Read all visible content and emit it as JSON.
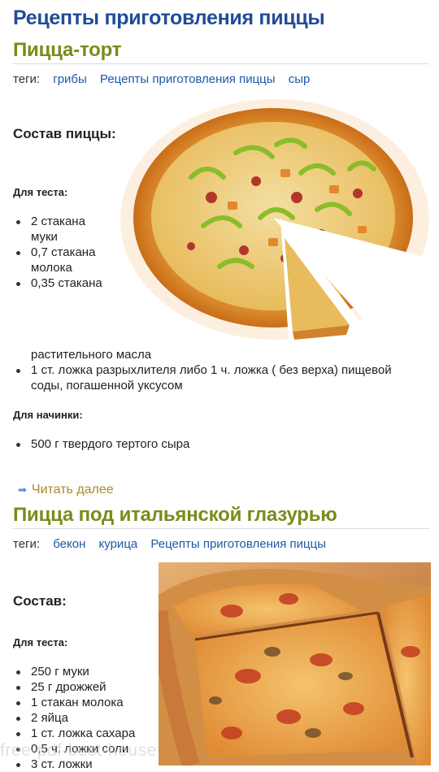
{
  "site": {
    "title": "Рецепты приготовления пиццы"
  },
  "post1": {
    "title": "Пицца-торт",
    "tags_label": "теги:",
    "tags": [
      "грибы",
      "Рецепты приготовления пиццы",
      "сыр"
    ],
    "composition_heading": "Состав пиццы:",
    "dough_heading": "Для теста:",
    "dough_items": [
      "2 стакана муки",
      "0,7 стакана молока",
      "0,35 стакана"
    ],
    "dough_item3_cont": "растительного масла",
    "dough_item4": "1 ст. ложка разрыхлителя либо 1 ч. ложка ( без верха) пищевой соды, погашенной уксусом",
    "filling_heading": "Для начинки:",
    "filling_items": [
      "500 г твердого тертого сыра"
    ],
    "read_more": "Читать далее"
  },
  "post2": {
    "title": "Пицца под итальянской глазурью",
    "tags_label": "теги:",
    "tags": [
      "бекон",
      "курица",
      "Рецепты приготовления пиццы"
    ],
    "composition_heading": "Состав:",
    "dough_heading": "Для теста:",
    "dough_items": [
      "250 г муки",
      "25 г дрожжей",
      "1 стакан молока",
      "2 яйца",
      "1 ст. ложка сахара",
      "0,5 ч. ложки соли",
      "3 ст. ложки"
    ]
  },
  "watermark": "free-pdf-best-house"
}
